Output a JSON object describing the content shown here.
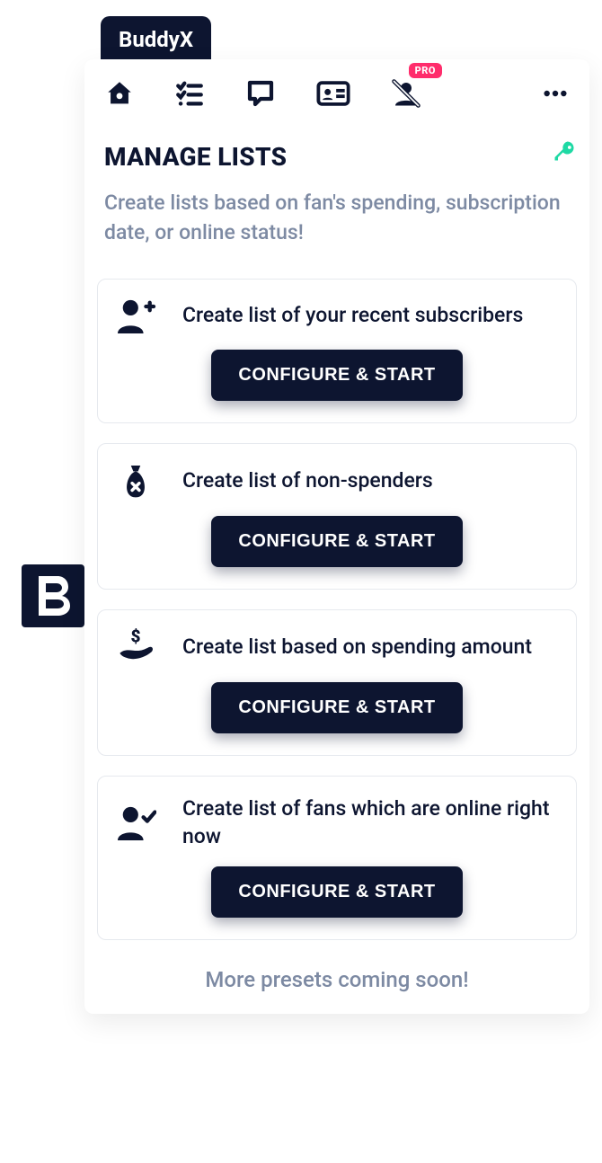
{
  "app": {
    "name": "BuddyX"
  },
  "nav": {
    "icons": [
      "home-icon",
      "checklist-icon",
      "chat-icon",
      "id-card-icon",
      "user-off-icon",
      "more-icon"
    ],
    "pro_badge": "PRO"
  },
  "section": {
    "title": "MANAGE LISTS",
    "subtitle": "Create lists based on fan's spending, subscription date, or online status!"
  },
  "cards": [
    {
      "icon": "user-plus-icon",
      "label": "Create list of your recent subscribers",
      "button": "CONFIGURE & START"
    },
    {
      "icon": "money-bag-x-icon",
      "label": "Create list of non-spenders",
      "button": "CONFIGURE & START"
    },
    {
      "icon": "hand-dollar-icon",
      "label": "Create list based on spending amount",
      "button": "CONFIGURE & START"
    },
    {
      "icon": "user-check-icon",
      "label": "Create list of fans which are online right now",
      "button": "CONFIGURE & START"
    }
  ],
  "footer": "More presets coming soon!"
}
